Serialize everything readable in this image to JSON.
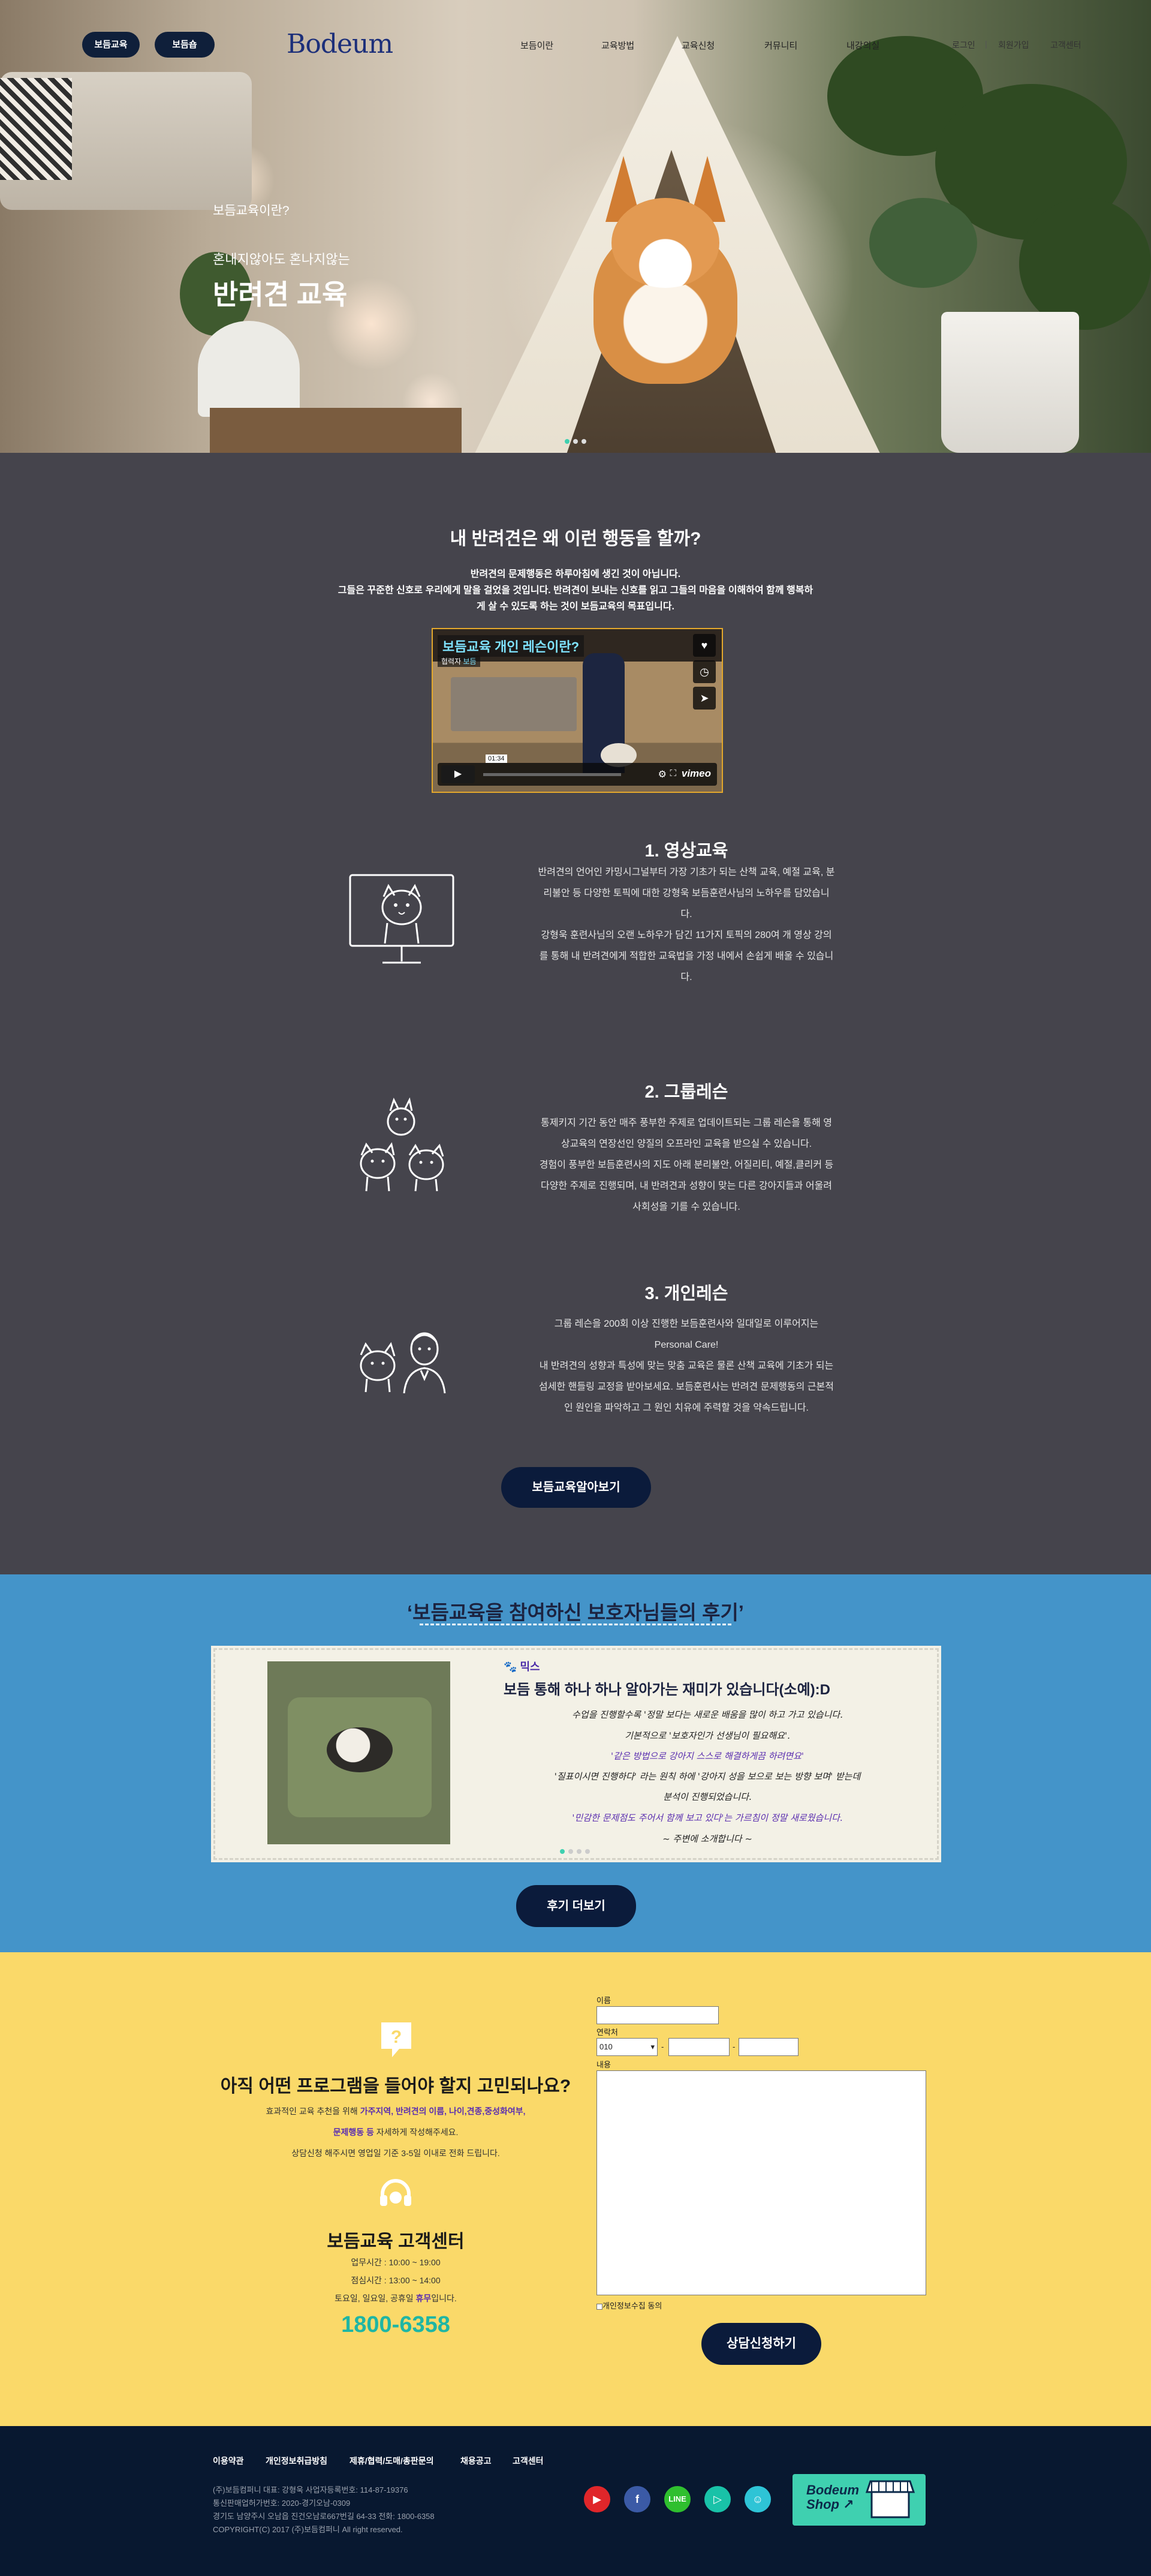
{
  "header": {
    "pills": [
      "보듬교육",
      "보듬숍"
    ],
    "logo": "Bodeum",
    "menu": [
      "보듬이란",
      "교육방법",
      "교육신청",
      "커뮤니티",
      "내강의실"
    ],
    "util": [
      "로그인",
      "회원가입",
      "고객센터"
    ]
  },
  "hero": {
    "question": "보듬교육이란?",
    "line": "혼내지않아도 혼나지않는",
    "title": "반려견 교육",
    "dots": 3,
    "active_dot": 0
  },
  "intro": {
    "title": "내 반려견은 왜 이런 행동을 할까?",
    "lines": [
      "반려견의 문제행동은 하루아침에 생긴 것이 아닙니다.",
      "그들은 꾸준한 신호로 우리에게 말을 걸었을 것입니다. 반려견이 보내는 신호를 읽고 그들의 마음을 이해하여 함께 행복하",
      "게 살 수 있도록 하는 것이 보듬교육의 목표입니다."
    ]
  },
  "video": {
    "title": "보듬교육 개인 레슨이란?",
    "tag_prefix": "협력자",
    "tag_suffix": "보듬",
    "time": "01:34",
    "brand": "vimeo"
  },
  "programs": [
    {
      "title": "1. 영상교육",
      "lines": [
        "반려견의 언어인 카밍시그널부터 가장 기초가 되는 산책 교육, 예절 교육, 분",
        "리불안 등 다양한 토픽에 대한 강형욱 보듬훈련사님의 노하우를 담았습니",
        "다.",
        "강형욱 훈련사님의 오랜 노하우가 담긴 11가지 토픽의 280여 개 영상 강의",
        "를 통해 내 반려견에게 적합한 교육법을 가정 내에서 손쉽게 배울 수 있습니",
        "다."
      ]
    },
    {
      "title": "2. 그룹레슨",
      "lines": [
        "통제키지 기간 동안 매주 풍부한 주제로 업데이트되는 그룹 레슨을 통해 영",
        "상교육의 연장선인 양질의 오프라인 교육을 받으실 수 있습니다.",
        "경험이 풍부한 보듬훈련사의 지도 아래 분리불안, 어질리티, 예절,클리커 등",
        "다양한 주제로 진행되며, 내 반려견과 성향이 맞는 다른 강아지들과 어울려",
        "사회성을 기를 수 있습니다."
      ]
    },
    {
      "title": "3. 개인레슨",
      "lines": [
        "그룹 레슨을 200회 이상 진행한 보듬훈련사와 일대일로 이루어지는",
        "Personal Care!",
        "내 반려견의 성향과 특성에 맞는 맞춤 교육은 물론 산책 교육에 기초가 되는",
        "섬세한 핸들링 교정을 받아보세요. 보듬훈련사는 반려견 문제행동의 근본적",
        "인 원인을 파악하고 그 원인 치유에 주력할 것을 약속드립니다."
      ]
    }
  ],
  "learn_more_button": "보듬교육알아보기",
  "reviews": {
    "title": "‘보듬교육을 참여하신 보호자님들의 후기’",
    "name": "믹스",
    "headline": "보듬 통해 하나 하나 알아가는 재미가 있습니다(소예):D",
    "lines": [
      "수업을 진행할수록 '정말 보다는 새로운 배움을 많이 하고 가고 있습니다.",
      "기본적으로 '보호자인가 선생님이 필요해요'.",
      "'같은 방법으로 강아지 스스로 해결하게끔 하려면요'",
      "'질표이시면 진행하다' 라는 원칙 하에 '강아지 성을 보으로 보는 방향 보며' 받는데",
      "분석이 진행되었습니다.",
      "'민감한 문제점도 주어서 함께 보고 있다'는 가르침이 정말 새로웠습니다.",
      "~ 주변에 소개합니다 ~"
    ],
    "dots": 4,
    "active_dot": 0,
    "more_button": "후기 더보기"
  },
  "consult": {
    "title": "아직 어떤 프로그램을 들어야 할지 고민되나요?",
    "line1_prefix": "효과적인 교육 추천을 위해 ",
    "line1_highlight": "가주지역, 반려견의 이름, 나이,견종,중성화여부,",
    "line2_highlight": "문제행동 등",
    "line2_suffix": " 자세하게 작성해주세요.",
    "line3": "상담신청 해주시면 영업일 기준 3-5일 이내로 전화 드립니다.",
    "center_title": "보듬교육 고객센터",
    "hours1": "업무시간 : 10:00 ~ 19:00",
    "hours2": "점심시간 : 13:00 ~ 14:00",
    "holiday_prefix": "토요일, 일요일, 공휴일 ",
    "holiday_highlight": "휴무",
    "holiday_suffix": "입니다.",
    "phone": "1800-6358",
    "form": {
      "name_label": "이름",
      "contact_label": "연락처",
      "phone_prefix": "010",
      "content_label": "내용",
      "agree_label": "개인정보수집 동의",
      "submit": "상담신청하기"
    }
  },
  "footer": {
    "links": [
      "이용약관",
      "개인정보취급방침",
      "제휴/협력/도매/총판문의",
      "채용공고",
      "고객센터"
    ],
    "info": [
      "(주)보듬컴퍼니     대표: 강형욱     사업자등록번호: 114-87-19376",
      "통신판매업허가번호: 2020-경기오남-0309",
      "경기도 남양주시 오남읍 진건오남로667번길 64-33     전화: 1800-6358",
      "COPYRIGHT(C) 2017 (주)보듬컴퍼니 All right reserved."
    ],
    "sns": [
      "youtube-icon",
      "facebook-icon",
      "line-icon",
      "play-icon",
      "chat-icon"
    ],
    "sns_colors": [
      "#e0262a",
      "#3b5aa6",
      "#2fbf2f",
      "#19c2a8",
      "#2ec4d6"
    ],
    "shop_line1": "Bodeum",
    "shop_line2": "Shop ↗"
  },
  "colors": {
    "navy": "#0b1b3b",
    "dark_bg": "#45444c",
    "blue_bg": "#4494c9",
    "yellow_bg": "#fad969",
    "footer_bg": "#081830",
    "accent_purple": "#5b2fb0",
    "phone_teal": "#1fb6a4"
  }
}
